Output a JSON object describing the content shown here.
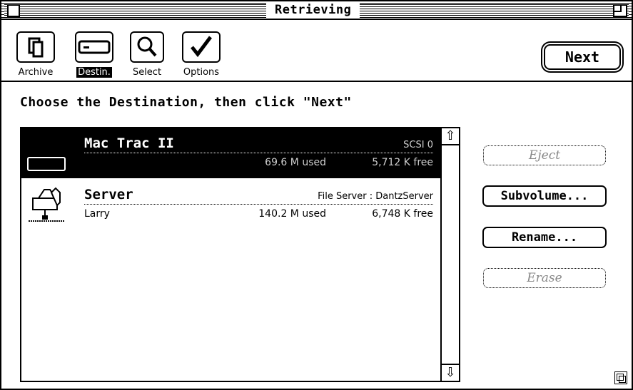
{
  "window": {
    "title": "Retrieving"
  },
  "toolbar": {
    "tools": [
      {
        "label": "Archive",
        "icon": "document-icon"
      },
      {
        "label": "Destin.",
        "icon": "drive-icon"
      },
      {
        "label": "Select",
        "icon": "magnifier-icon"
      },
      {
        "label": "Options",
        "icon": "checkmark-icon"
      }
    ],
    "next_label": "Next"
  },
  "prompt": "Choose the Destination, then click \"Next\"",
  "destinations": [
    {
      "name": "Mac Trac II",
      "kind": "SCSI 0",
      "owner": "",
      "used": "69.6 M used",
      "free": "5,712 K free",
      "icon": "hard-drive-icon",
      "selected": true
    },
    {
      "name": "Server",
      "kind": "File Server : DantzServer",
      "owner": "Larry",
      "used": "140.2 M used",
      "free": "6,748 K free",
      "icon": "file-server-icon",
      "selected": false
    }
  ],
  "buttons": {
    "eject": "Eject",
    "subvolume": "Subvolume...",
    "rename": "Rename...",
    "erase": "Erase"
  }
}
